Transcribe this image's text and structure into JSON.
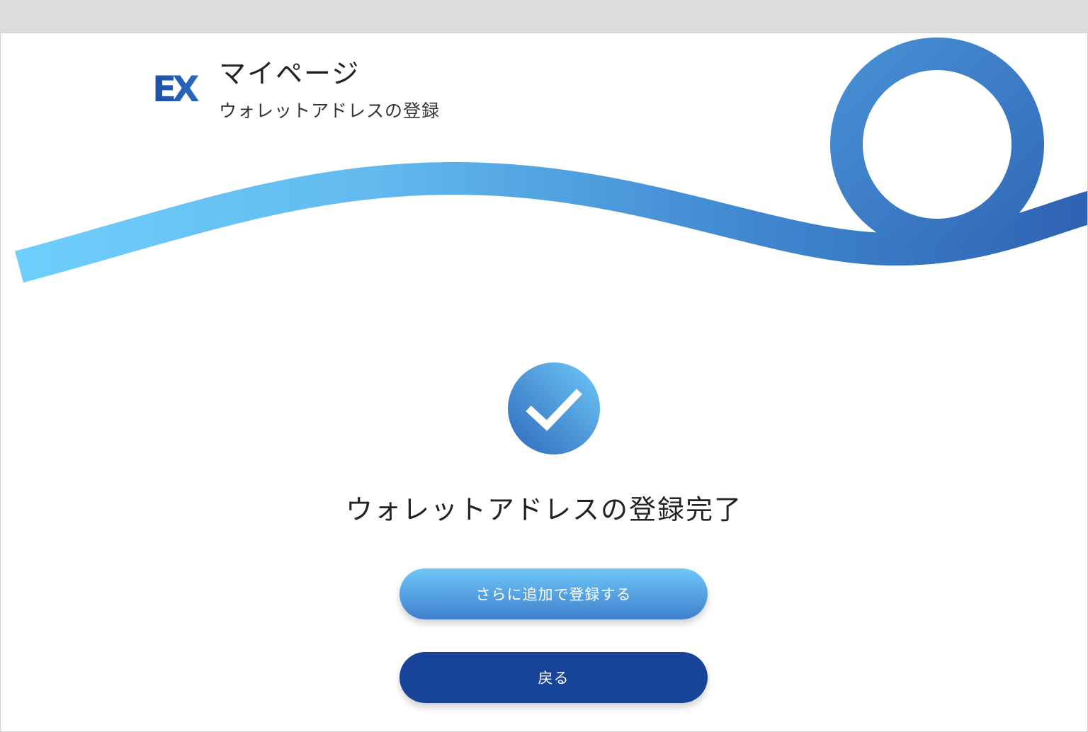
{
  "header": {
    "logo_text": "EX",
    "title": "マイページ",
    "subtitle": "ウォレットアドレスの登録"
  },
  "main": {
    "complete_message": "ウォレットアドレスの登録完了",
    "add_button_label": "さらに追加で登録する",
    "back_button_label": "戻る"
  },
  "colors": {
    "wave_light": "#6fcffb",
    "wave_dark": "#2e63b4",
    "back_button": "#174498",
    "text": "#222222"
  }
}
